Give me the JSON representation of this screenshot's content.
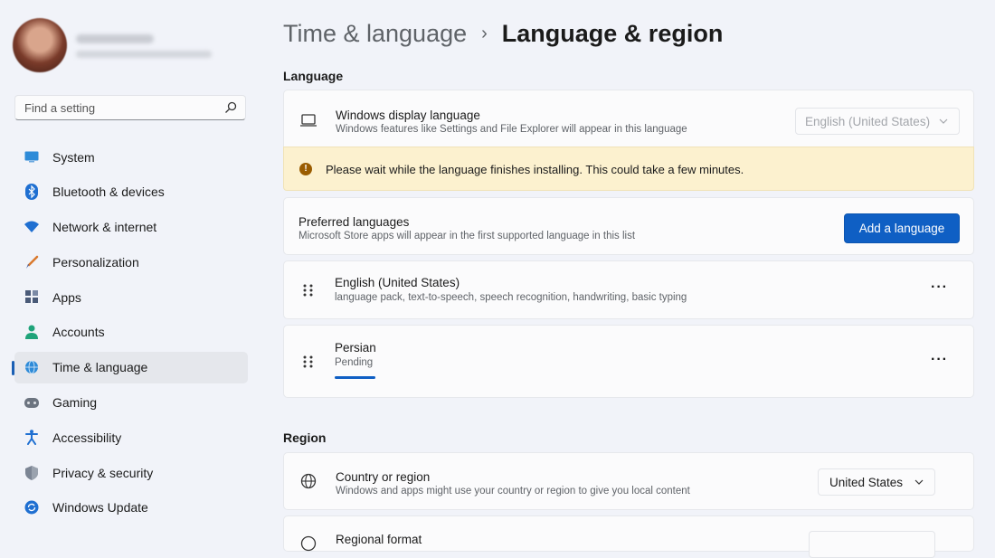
{
  "sidebar": {
    "search": {
      "placeholder": "Find a setting",
      "icon": "search-icon"
    },
    "items": [
      {
        "label": "System",
        "icon": "monitor-icon",
        "color": "#2e8bd8"
      },
      {
        "label": "Bluetooth & devices",
        "icon": "bluetooth-icon",
        "color": "#1f6fd1"
      },
      {
        "label": "Network & internet",
        "icon": "wifi-icon",
        "color": "#1f6fd1"
      },
      {
        "label": "Personalization",
        "icon": "brush-icon",
        "color": "#d9782c"
      },
      {
        "label": "Apps",
        "icon": "apps-icon",
        "color": "#4a5a78"
      },
      {
        "label": "Accounts",
        "icon": "person-icon",
        "color": "#1fa37a"
      },
      {
        "label": "Time & language",
        "icon": "globe-clock-icon",
        "color": "#2e8bd8",
        "active": true
      },
      {
        "label": "Gaming",
        "icon": "gamepad-icon",
        "color": "#6c7480"
      },
      {
        "label": "Accessibility",
        "icon": "accessibility-icon",
        "color": "#1f6fd1"
      },
      {
        "label": "Privacy & security",
        "icon": "shield-icon",
        "color": "#7c8594"
      },
      {
        "label": "Windows Update",
        "icon": "update-icon",
        "color": "#1f6fd1"
      }
    ]
  },
  "header": {
    "parent": "Time & language",
    "separator": "›",
    "current": "Language & region"
  },
  "language_section": {
    "label": "Language",
    "display_language": {
      "title": "Windows display language",
      "desc": "Windows features like Settings and File Explorer will appear in this language",
      "value": "English (United States)"
    },
    "warning": "Please wait while the language finishes installing. This could take a few minutes.",
    "preferred": {
      "title": "Preferred languages",
      "desc": "Microsoft Store apps will appear in the first supported language in this list",
      "button": "Add a language"
    },
    "languages": [
      {
        "name": "English (United States)",
        "desc": "language pack, text-to-speech, speech recognition, handwriting, basic typing",
        "more": "···"
      },
      {
        "name": "Persian",
        "desc": "Pending",
        "more": "···"
      }
    ]
  },
  "region_section": {
    "label": "Region",
    "country": {
      "title": "Country or region",
      "desc": "Windows and apps might use your country or region to give you local content",
      "value": "United States"
    },
    "format": {
      "title": "Regional format"
    }
  },
  "colors": {
    "accent": "#0f5fc4",
    "warning_bg": "#fcf1cf"
  }
}
